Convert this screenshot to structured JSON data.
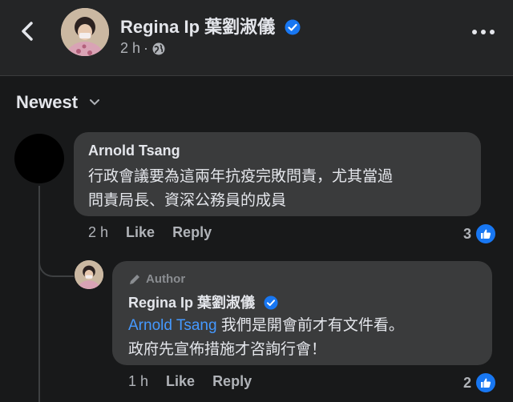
{
  "post_header": {
    "poster_name": "Regina Ip 葉劉淑儀",
    "time": "2 h",
    "dot": "·"
  },
  "sort": {
    "label": "Newest"
  },
  "comments": [
    {
      "author": "Arnold Tsang",
      "text_line1": "行政會議要為這兩年抗疫完敗問責，尤其當過",
      "text_line2": "問責局長、資深公務員的成員",
      "time": "2 h",
      "like_label": "Like",
      "reply_label": "Reply",
      "reaction_count": "3"
    }
  ],
  "reply": {
    "badge": "Author",
    "author": "Regina Ip 葉劉淑儀",
    "mention": "Arnold Tsang",
    "text_line1": " 我們是開會前才有文件看。",
    "text_line2": "政府先宣佈措施才咨詢行會！",
    "time": "1 h",
    "like_label": "Like",
    "reply_label": "Reply",
    "reaction_count": "2"
  },
  "icons": {
    "back": "chevron-left-icon",
    "more": "more-dots-icon",
    "globe": "globe-icon",
    "verified": "verified-badge-icon",
    "like": "thumbs-up-icon",
    "author": "pencil-icon",
    "sort": "chevron-down-icon"
  },
  "colors": {
    "background": "#18191a",
    "bubble": "#3a3b3c",
    "accent": "#1877f2",
    "mention": "#4599ff"
  }
}
